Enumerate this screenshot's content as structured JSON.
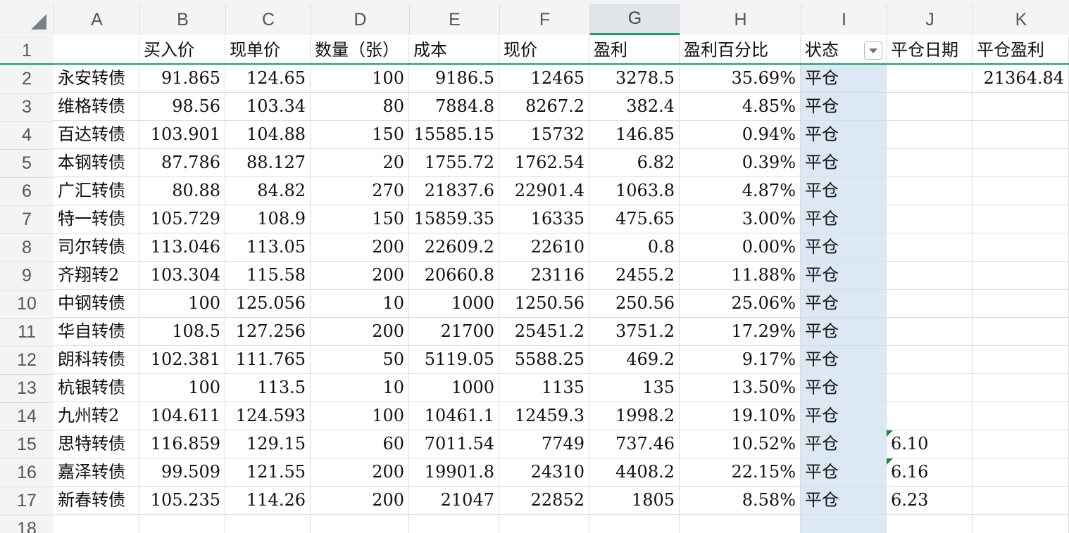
{
  "columns": [
    "A",
    "B",
    "C",
    "D",
    "E",
    "F",
    "G",
    "H",
    "I",
    "J",
    "K"
  ],
  "selected_column": "G",
  "row_numbers": [
    "1",
    "2",
    "3",
    "4",
    "5",
    "6",
    "7",
    "8",
    "9",
    "10",
    "11",
    "12",
    "13",
    "14",
    "15",
    "16",
    "17",
    "18"
  ],
  "header_row": [
    "",
    "买入价",
    "现单价",
    "数量（张）",
    "成本",
    "现价",
    "盈利",
    "盈利百分比",
    "状态",
    "平仓日期",
    "平仓盈利"
  ],
  "rows": [
    [
      "永安转债",
      "91.865",
      "124.65",
      "100",
      "9186.5",
      "12465",
      "3278.5",
      "35.69%",
      "平仓",
      "",
      "21364.84"
    ],
    [
      "维格转债",
      "98.56",
      "103.34",
      "80",
      "7884.8",
      "8267.2",
      "382.4",
      "4.85%",
      "平仓",
      "",
      ""
    ],
    [
      "百达转债",
      "103.901",
      "104.88",
      "150",
      "15585.15",
      "15732",
      "146.85",
      "0.94%",
      "平仓",
      "",
      ""
    ],
    [
      "本钢转债",
      "87.786",
      "88.127",
      "20",
      "1755.72",
      "1762.54",
      "6.82",
      "0.39%",
      "平仓",
      "",
      ""
    ],
    [
      "广汇转债",
      "80.88",
      "84.82",
      "270",
      "21837.6",
      "22901.4",
      "1063.8",
      "4.87%",
      "平仓",
      "",
      ""
    ],
    [
      "特一转债",
      "105.729",
      "108.9",
      "150",
      "15859.35",
      "16335",
      "475.65",
      "3.00%",
      "平仓",
      "",
      ""
    ],
    [
      "司尔转债",
      "113.046",
      "113.05",
      "200",
      "22609.2",
      "22610",
      "0.8",
      "0.00%",
      "平仓",
      "",
      ""
    ],
    [
      "齐翔转2",
      "103.304",
      "115.58",
      "200",
      "20660.8",
      "23116",
      "2455.2",
      "11.88%",
      "平仓",
      "",
      ""
    ],
    [
      "中钢转债",
      "100",
      "125.056",
      "10",
      "1000",
      "1250.56",
      "250.56",
      "25.06%",
      "平仓",
      "",
      ""
    ],
    [
      "华自转债",
      "108.5",
      "127.256",
      "200",
      "21700",
      "25451.2",
      "3751.2",
      "17.29%",
      "平仓",
      "",
      ""
    ],
    [
      "朗科转债",
      "102.381",
      "111.765",
      "50",
      "5119.05",
      "5588.25",
      "469.2",
      "9.17%",
      "平仓",
      "",
      ""
    ],
    [
      "杭银转债",
      "100",
      "113.5",
      "10",
      "1000",
      "1135",
      "135",
      "13.50%",
      "平仓",
      "",
      ""
    ],
    [
      "九州转2",
      "104.611",
      "124.593",
      "100",
      "10461.1",
      "12459.3",
      "1998.2",
      "19.10%",
      "平仓",
      "",
      ""
    ],
    [
      "思特转债",
      "116.859",
      "129.15",
      "60",
      "7011.54",
      "7749",
      "737.46",
      "10.52%",
      "平仓",
      "6.10",
      ""
    ],
    [
      "嘉泽转债",
      "99.509",
      "121.55",
      "200",
      "19901.8",
      "24310",
      "4408.2",
      "22.15%",
      "平仓",
      "6.16",
      ""
    ],
    [
      "新春转债",
      "105.235",
      "114.26",
      "200",
      "21047",
      "22852",
      "1805",
      "8.58%",
      "平仓",
      "6.23",
      ""
    ]
  ],
  "colors": {
    "header_bg": "#f3f4f6",
    "grid": "#d9dce1",
    "accent_green": "#1aa260",
    "status_column_highlight": "#dce9f4"
  },
  "icons": {
    "corner": "select-all-triangle",
    "filter": "filter-dropdown-icon",
    "comment": "comment-indicator-triangle"
  }
}
